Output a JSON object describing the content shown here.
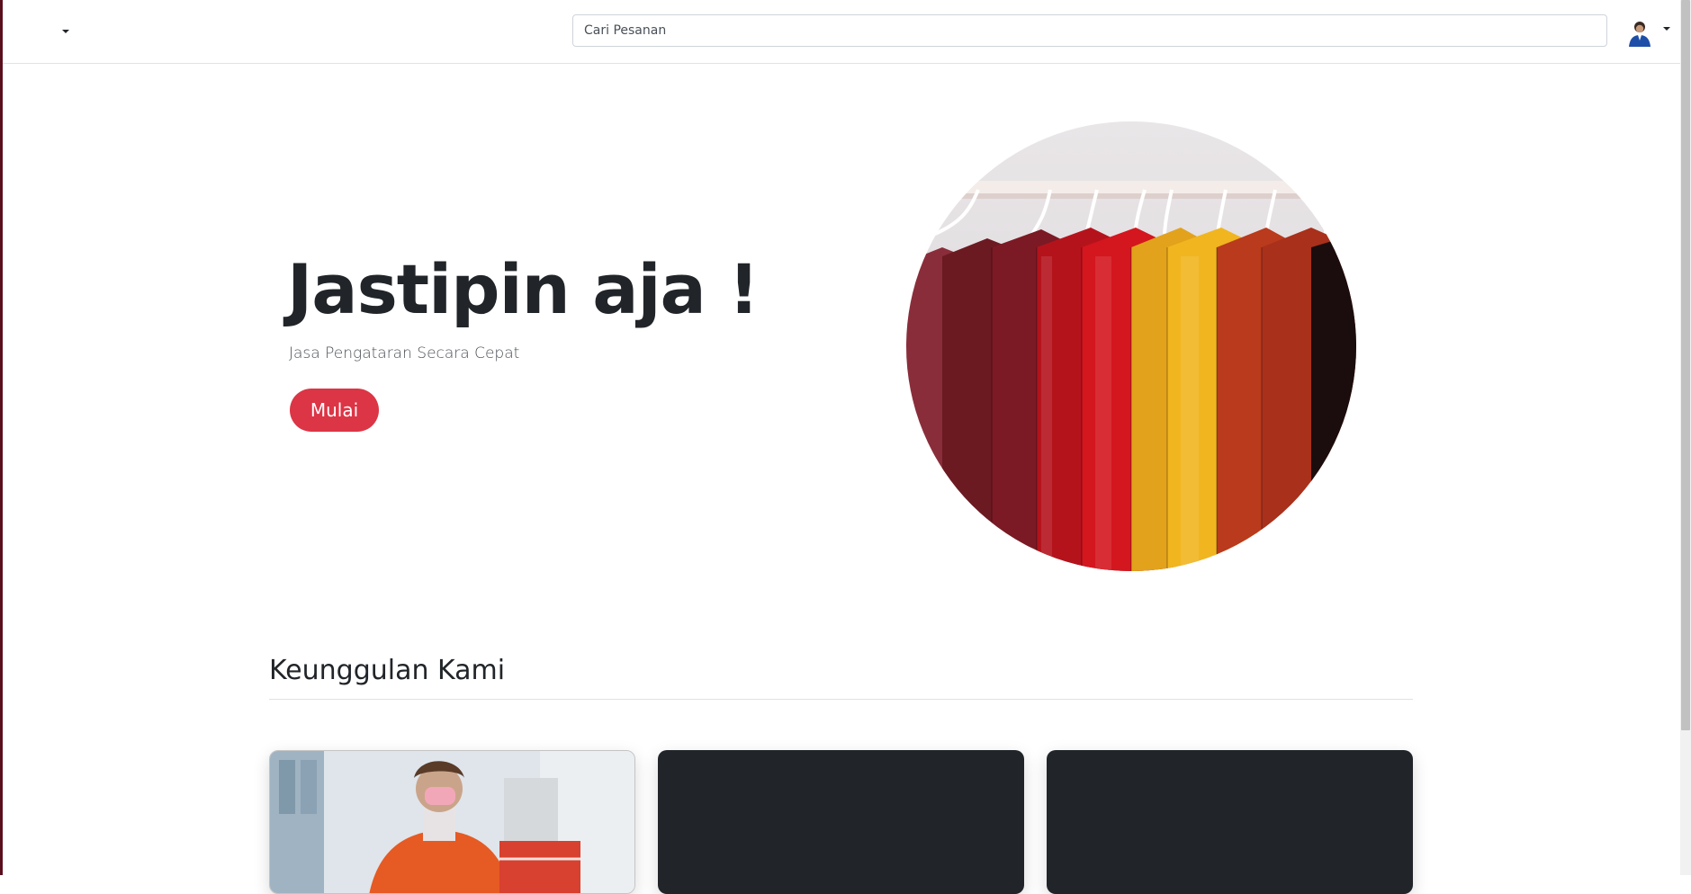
{
  "header": {
    "search_placeholder": "Cari Pesanan"
  },
  "hero": {
    "title": "Jastipin aja !",
    "subtitle": "Jasa Pengataran Secara Cepat",
    "cta_label": "Mulai"
  },
  "features": {
    "title": "Keunggulan Kami"
  },
  "colors": {
    "accent": "#dc3545",
    "dark_card": "#212529",
    "text": "#212529"
  },
  "icons": [
    "chevron-down-icon",
    "avatar-icon"
  ]
}
